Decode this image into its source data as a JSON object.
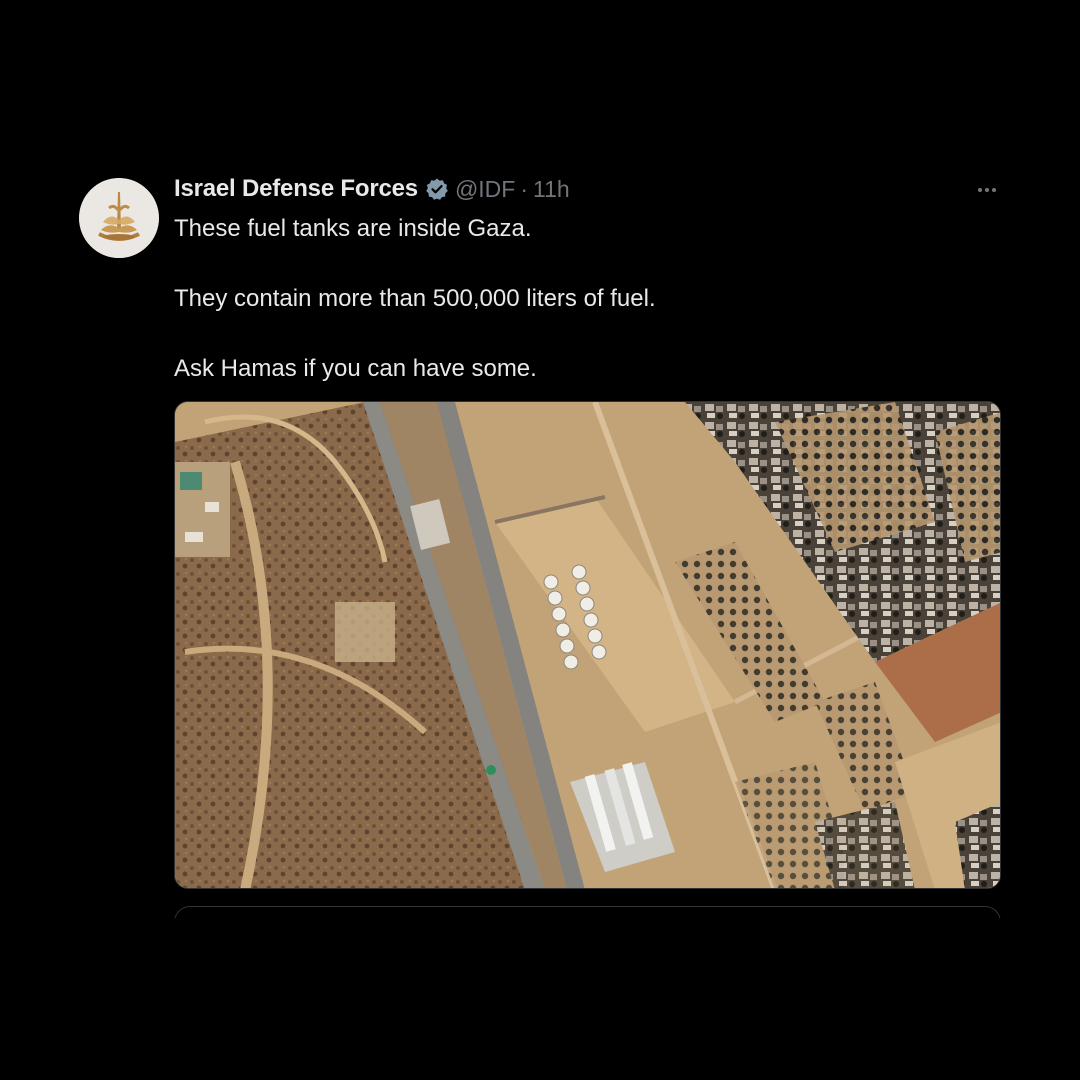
{
  "author": {
    "display_name": "Israel Defense Forces",
    "handle": "@IDF",
    "separator": "·",
    "time": "11h",
    "verified": true,
    "avatar_icon": "idf-emblem-icon",
    "verified_icon": "verified-badge-icon",
    "verified_color": "#829aab"
  },
  "tweet": {
    "paragraphs": [
      "These fuel tanks are inside Gaza.",
      "They contain more than 500,000 liters of fuel.",
      "Ask Hamas if you can have some."
    ],
    "more_icon": "more-options-icon"
  },
  "media": {
    "type": "satellite-image"
  },
  "colors": {
    "background": "#000000",
    "text_primary": "#e7e9ea",
    "text_secondary": "#71767b",
    "border": "#2f3336"
  }
}
